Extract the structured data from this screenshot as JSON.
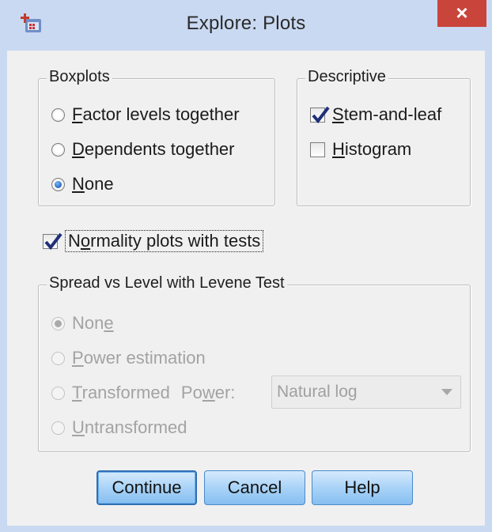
{
  "window": {
    "title": "Explore: Plots",
    "close_label": "×"
  },
  "boxplots": {
    "legend": "Boxplots",
    "options": [
      {
        "mnemonic": "F",
        "rest": "actor levels together",
        "selected": false
      },
      {
        "mnemonic": "D",
        "rest": "ependents together",
        "selected": false
      },
      {
        "mnemonic": "N",
        "rest": "one",
        "selected": true
      }
    ]
  },
  "descriptive": {
    "legend": "Descriptive",
    "stem_leaf": {
      "mnemonic": "S",
      "rest": "tem-and-leaf",
      "checked": true
    },
    "histogram": {
      "mnemonic": "H",
      "rest": "istogram",
      "checked": false
    }
  },
  "normality": {
    "before": "N",
    "mnemonic": "o",
    "rest": "rmality plots with tests",
    "checked": true
  },
  "spread": {
    "legend": "Spread vs Level with Levene Test",
    "options": [
      {
        "before": "Non",
        "mnemonic": "e",
        "rest": "",
        "selected": true
      },
      {
        "before": "",
        "mnemonic": "P",
        "rest": "ower estimation",
        "selected": false
      },
      {
        "before": "",
        "mnemonic": "T",
        "rest": "ransformed",
        "selected": false
      },
      {
        "before": "",
        "mnemonic": "U",
        "rest": "ntransformed",
        "selected": false
      }
    ],
    "power_label": {
      "before": "Po",
      "mnemonic": "w",
      "rest": "er:"
    },
    "power_value": "Natural log"
  },
  "buttons": {
    "continue": "Continue",
    "cancel": "Cancel",
    "help": "Help"
  }
}
